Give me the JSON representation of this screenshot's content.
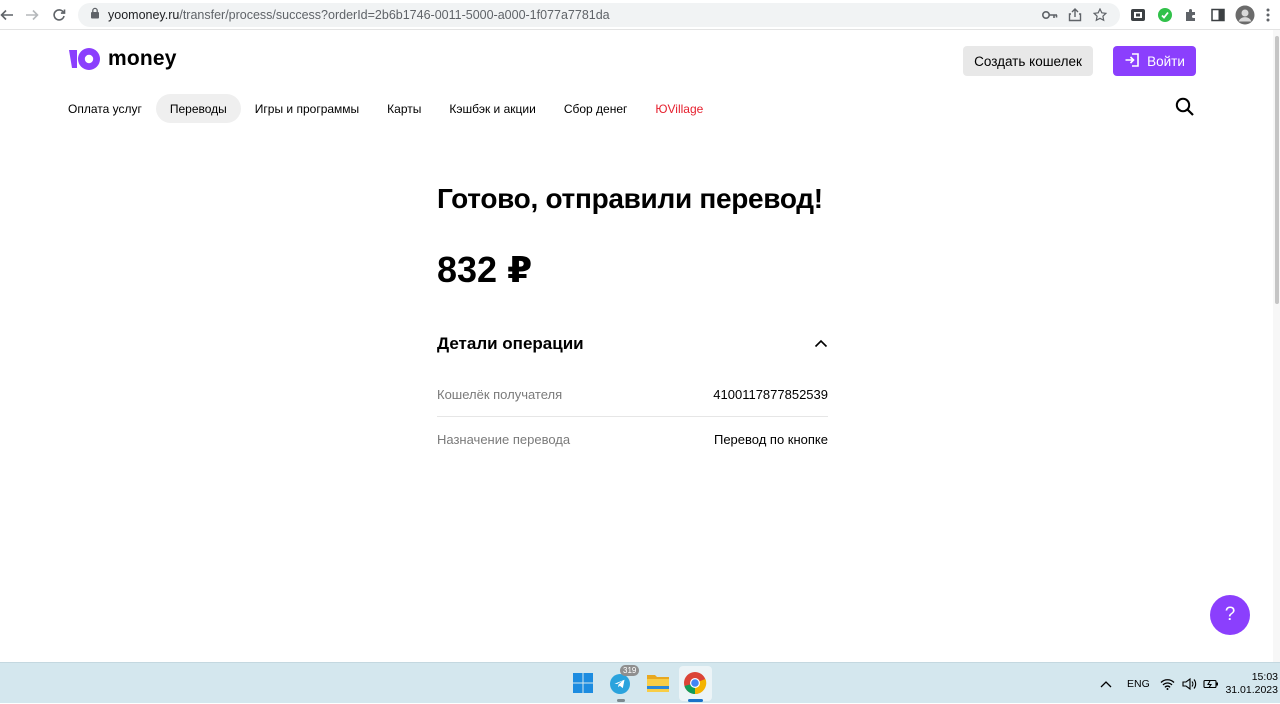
{
  "browser": {
    "url_host": "yoomoney.ru",
    "url_path": "/transfer/process/success?orderId=2b6b1746-0011-5000-a000-1f077a7781da"
  },
  "header": {
    "logo_text": "money",
    "create_wallet_label": "Создать кошелек",
    "login_label": "Войти"
  },
  "nav": {
    "items": [
      {
        "label": "Оплата услуг"
      },
      {
        "label": "Переводы"
      },
      {
        "label": "Игры и программы"
      },
      {
        "label": "Карты"
      },
      {
        "label": "Кэшбэк и акции"
      },
      {
        "label": "Сбор денег"
      },
      {
        "label": "ЮVillage"
      }
    ],
    "active_index": 1
  },
  "main": {
    "title": "Готово, отправили перевод!",
    "amount": "832 ₽",
    "details_title": "Детали операции",
    "rows": [
      {
        "label": "Кошелёк получателя",
        "value": "4100117877852539"
      },
      {
        "label": "Назначение перевода",
        "value": "Перевод по кнопке"
      }
    ]
  },
  "help_label": "?",
  "taskbar": {
    "telegram_badge": "319",
    "language": "ENG",
    "time": "15:03",
    "date": "31.01.2023"
  },
  "colors": {
    "brand_purple": "#8b3ffd",
    "village_red": "#e61f2d"
  }
}
